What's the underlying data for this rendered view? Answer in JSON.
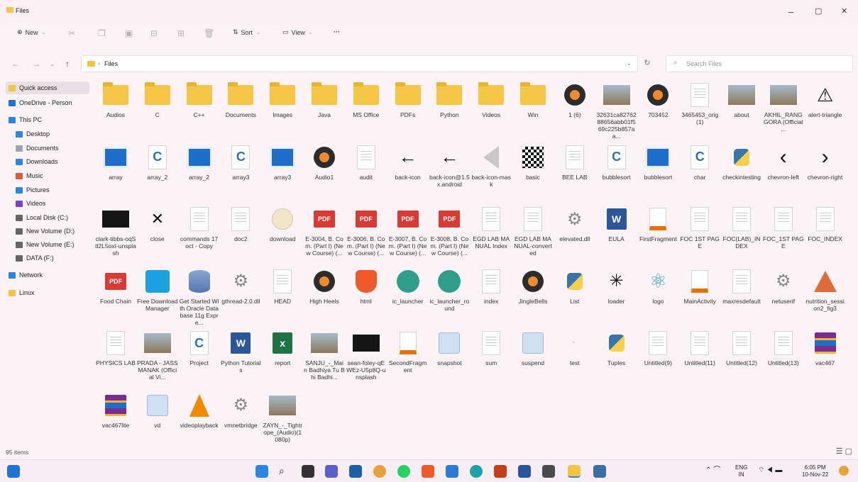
{
  "window": {
    "title": "Files",
    "minimize": "–",
    "maximize": "▢",
    "close": "✕"
  },
  "toolbar": {
    "new_label": "New",
    "sort_label": "Sort",
    "view_label": "View",
    "more_label": "···"
  },
  "address": {
    "path": "Files",
    "search_placeholder": "Search Files"
  },
  "sidebar": {
    "items": [
      {
        "label": "Quick access",
        "icon": "star-icon"
      },
      {
        "label": "OneDrive - Person",
        "icon": "cloud-icon"
      },
      {
        "label": "This PC",
        "icon": "pc-icon"
      },
      {
        "label": "Desktop",
        "icon": "desktop-icon"
      },
      {
        "label": "Documents",
        "icon": "documents-icon"
      },
      {
        "label": "Downloads",
        "icon": "download-icon"
      },
      {
        "label": "Music",
        "icon": "music-icon"
      },
      {
        "label": "Pictures",
        "icon": "pictures-icon"
      },
      {
        "label": "Videos",
        "icon": "videos-icon"
      },
      {
        "label": "Local Disk (C:)",
        "icon": "drive-icon"
      },
      {
        "label": "New Volume (D:)",
        "icon": "drive-icon"
      },
      {
        "label": "New Volume (E:)",
        "icon": "drive-icon"
      },
      {
        "label": "DATA (F:)",
        "icon": "drive-icon"
      },
      {
        "label": "Network",
        "icon": "network-icon"
      },
      {
        "label": "Linux",
        "icon": "linux-icon"
      }
    ]
  },
  "files": [
    {
      "label": "Audios",
      "kind": "folder"
    },
    {
      "label": "C",
      "kind": "folder"
    },
    {
      "label": "C++",
      "kind": "folder"
    },
    {
      "label": "Documents",
      "kind": "folder"
    },
    {
      "label": "Images",
      "kind": "folder"
    },
    {
      "label": "Java",
      "kind": "folder"
    },
    {
      "label": "MS Office",
      "kind": "folder"
    },
    {
      "label": "PDFs",
      "kind": "folder"
    },
    {
      "label": "Python",
      "kind": "folder"
    },
    {
      "label": "Videos",
      "kind": "folder"
    },
    {
      "label": "Win",
      "kind": "folder"
    },
    {
      "label": "1 (6)",
      "kind": "media"
    },
    {
      "label": "32631ca8276288656abb01f569c225b857aa...",
      "kind": "photo"
    },
    {
      "label": "703452",
      "kind": "media"
    },
    {
      "label": "3465453_orig (1)",
      "kind": "doc"
    },
    {
      "label": "about",
      "kind": "photo"
    },
    {
      "label": "AKHIL_RANGGORA (Official ...",
      "kind": "photo"
    },
    {
      "label": "alert-triangle",
      "kind": "alert"
    },
    {
      "label": "array",
      "kind": "blue"
    },
    {
      "label": "array_2",
      "kind": "c"
    },
    {
      "label": "array_2",
      "kind": "blue"
    },
    {
      "label": "array3",
      "kind": "c"
    },
    {
      "label": "array3",
      "kind": "blue"
    },
    {
      "label": "Audio1",
      "kind": "media"
    },
    {
      "label": "audit",
      "kind": "doc"
    },
    {
      "label": "back-icon",
      "kind": "arrow"
    },
    {
      "label": "back-icon@1.5x.android",
      "kind": "arrow"
    },
    {
      "label": "back-icon-mask",
      "kind": "mask"
    },
    {
      "label": "basic",
      "kind": "qr"
    },
    {
      "label": "BEE LAB",
      "kind": "doc"
    },
    {
      "label": "bubblesort",
      "kind": "c"
    },
    {
      "label": "bubblesort",
      "kind": "blue"
    },
    {
      "label": "char",
      "kind": "c"
    },
    {
      "label": "checkintesting",
      "kind": "py"
    },
    {
      "label": "chevron-left",
      "kind": "chevl"
    },
    {
      "label": "chevron-right",
      "kind": "chevr"
    },
    {
      "label": "clark-tibbs-oqStl2L5oxI-unsplash",
      "kind": "dark"
    },
    {
      "label": "close",
      "kind": "x"
    },
    {
      "label": "commands 17oct - Copy",
      "kind": "doc"
    },
    {
      "label": "doc2",
      "kind": "doc"
    },
    {
      "label": "download",
      "kind": "disc"
    },
    {
      "label": "E-3004, B. Com. (Part I) (New Course) (...",
      "kind": "pdf"
    },
    {
      "label": "E-3006, B. Com. (Part I) (New Course) (...",
      "kind": "pdf"
    },
    {
      "label": "E-3007, B. Com. (Part I) (New Course) (...",
      "kind": "pdf"
    },
    {
      "label": "E-3008, B. Com. (Part I) (New Course) (...",
      "kind": "pdf"
    },
    {
      "label": "EGD LAB MANUAL Index",
      "kind": "doc"
    },
    {
      "label": "EGD LAB MANUAL-converted",
      "kind": "doc"
    },
    {
      "label": "elevated.dll",
      "kind": "gear"
    },
    {
      "label": "EULA",
      "kind": "word"
    },
    {
      "label": "FirstFragment",
      "kind": "java"
    },
    {
      "label": "FOC 1ST PAGE",
      "kind": "doc"
    },
    {
      "label": "FOC(LAB)_INDEX",
      "kind": "doc"
    },
    {
      "label": "FOC_1ST PAGE",
      "kind": "doc"
    },
    {
      "label": "FOC_INDEX",
      "kind": "doc"
    },
    {
      "label": "Food Chain",
      "kind": "pdf"
    },
    {
      "label": "Free Download Manager",
      "kind": "fdm"
    },
    {
      "label": "Get Started With Oracle Database 11g Expre...",
      "kind": "db"
    },
    {
      "label": "gthread-2.0.dll",
      "kind": "gear"
    },
    {
      "label": "HEAD",
      "kind": "doc"
    },
    {
      "label": "High Heels",
      "kind": "media"
    },
    {
      "label": "html",
      "kind": "brave"
    },
    {
      "label": "ic_launcher",
      "kind": "android"
    },
    {
      "label": "ic_launcher_round",
      "kind": "android"
    },
    {
      "label": "index",
      "kind": "doc"
    },
    {
      "label": "JingleBells",
      "kind": "media"
    },
    {
      "label": "List",
      "kind": "py"
    },
    {
      "label": "loader",
      "kind": "loader"
    },
    {
      "label": "logo",
      "kind": "react"
    },
    {
      "label": "MainActivity",
      "kind": "java"
    },
    {
      "label": "maxresdefault",
      "kind": "doc"
    },
    {
      "label": "netuserif",
      "kind": "gear"
    },
    {
      "label": "nutrition_session2_fig3",
      "kind": "pyramid"
    },
    {
      "label": "PHYSICS LAB",
      "kind": "doc"
    },
    {
      "label": "PRADA - JASS MANAK (Official Vi...",
      "kind": "photo"
    },
    {
      "label": "Project",
      "kind": "c"
    },
    {
      "label": "Python Tutorials",
      "kind": "word"
    },
    {
      "label": "report",
      "kind": "excel"
    },
    {
      "label": "SANJU_-_Main Badhiya Tu Bhi Badhi...",
      "kind": "photo"
    },
    {
      "label": "sean-foley-qEWEz-U5p8Q-unsplash",
      "kind": "dark"
    },
    {
      "label": "SecondFragment",
      "kind": "java"
    },
    {
      "label": "snapshot",
      "kind": "snap"
    },
    {
      "label": "sum",
      "kind": "doc"
    },
    {
      "label": "suspend",
      "kind": "snap"
    },
    {
      "label": "test",
      "kind": "blank"
    },
    {
      "label": "Tuples",
      "kind": "py"
    },
    {
      "label": "Untitled(9)",
      "kind": "doc"
    },
    {
      "label": "Untitled(11)",
      "kind": "doc"
    },
    {
      "label": "Untitled(12)",
      "kind": "doc"
    },
    {
      "label": "Untitled(13)",
      "kind": "doc"
    },
    {
      "label": "vac467",
      "kind": "rar"
    },
    {
      "label": "vac467lite",
      "kind": "rar"
    },
    {
      "label": "vd",
      "kind": "snap"
    },
    {
      "label": "videoplayback",
      "kind": "vlc"
    },
    {
      "label": "vmnetbridge",
      "kind": "gear"
    },
    {
      "label": "ZAYN_-_Tightrope_(Audio)(1080p)",
      "kind": "photo"
    }
  ],
  "status": {
    "item_count": "95 items"
  },
  "tray": {
    "lang_top": "ENG",
    "lang_bottom": "IN",
    "time": "6:05 PM",
    "date": "10-Nov-22"
  }
}
